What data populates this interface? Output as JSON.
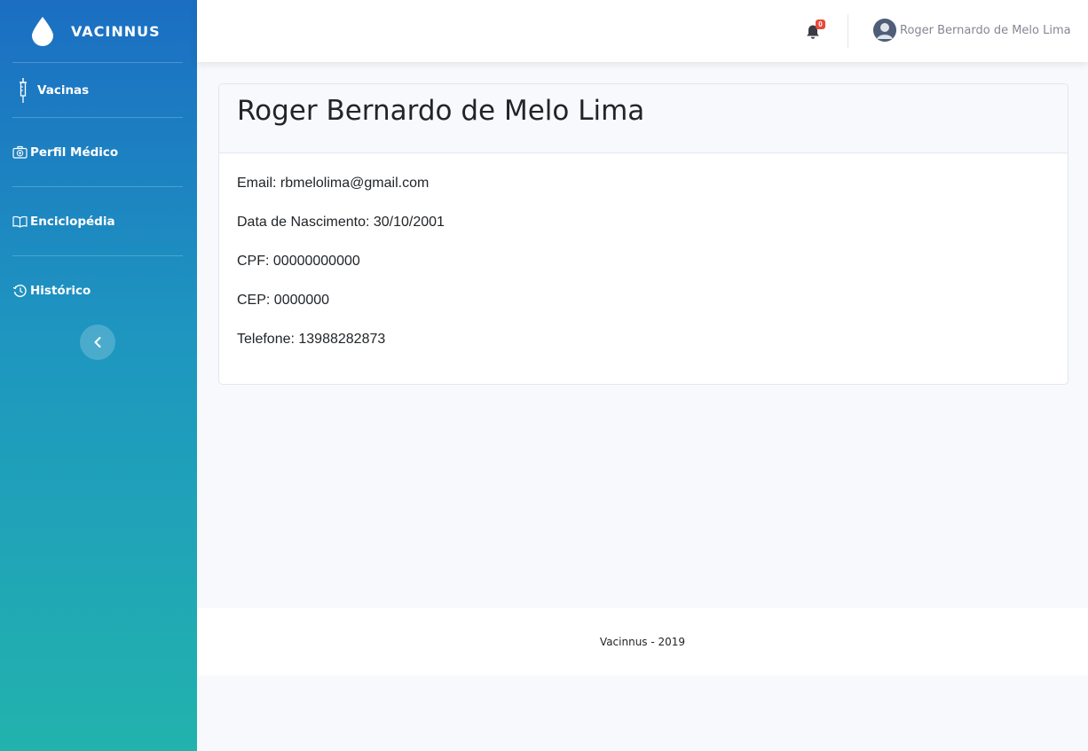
{
  "brand": {
    "name": "VACINNUS",
    "icon": "drop-icon"
  },
  "sidebar": {
    "items": [
      {
        "label": "Vacinas",
        "icon": "syringe-icon"
      },
      {
        "label": "Perfil Médico",
        "icon": "medical-kit-icon"
      },
      {
        "label": "Enciclopédia",
        "icon": "book-icon"
      },
      {
        "label": "Histórico",
        "icon": "history-icon"
      }
    ],
    "toggle_icon": "chevron-left-icon"
  },
  "topbar": {
    "notifications": {
      "icon": "bell-icon",
      "count": "0"
    },
    "user": {
      "name": "Roger Bernardo de Melo Lima",
      "avatar_icon": "user-avatar-icon"
    }
  },
  "profile": {
    "title": "Roger Bernardo de Melo Lima",
    "fields": [
      "Email: rbmelolima@gmail.com",
      "Data de Nascimento: 30/10/2001",
      "CPF: 00000000000",
      "CEP: 0000000",
      "Telefone: 13988282873"
    ]
  },
  "footer": {
    "text": "Vacinnus - 2019"
  },
  "colors": {
    "sidebar_gradient_top": "#1b6ec2",
    "sidebar_gradient_bottom": "#22b3ad",
    "page_background": "#f8f9fc",
    "badge": "#e74a3b"
  }
}
